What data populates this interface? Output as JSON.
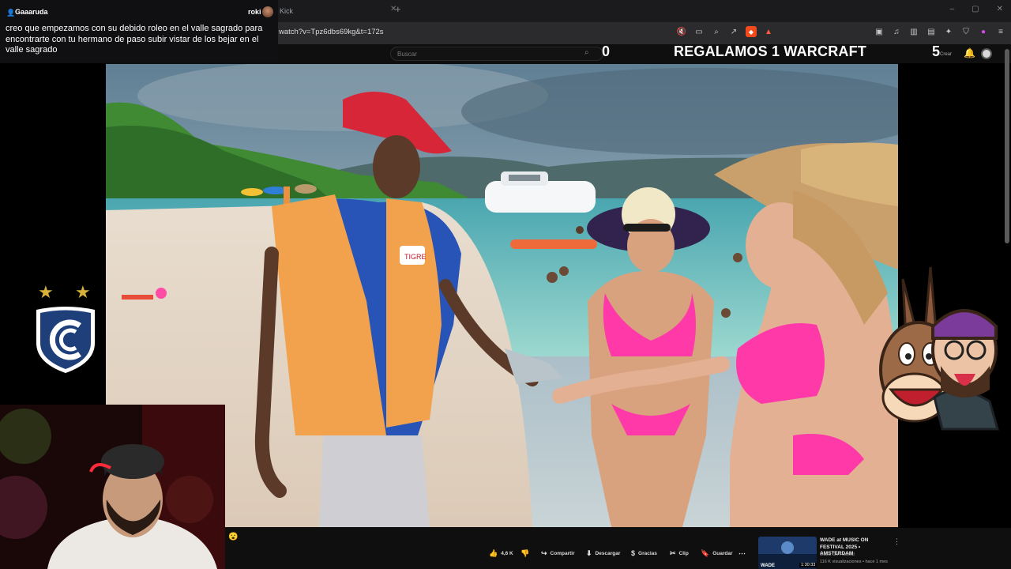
{
  "browser": {
    "tab_title": "Kick",
    "url": "watch?v=Tpz6dbs69kg&t=172s",
    "window_controls": [
      "–",
      "▢",
      "✕"
    ]
  },
  "youtube": {
    "search_placeholder": "Buscar",
    "create_label": "Crear"
  },
  "overlay": {
    "counter_left": "0",
    "promo_text": "REGALAMOS 1 WARCRAFT",
    "counter_right": "5"
  },
  "chat": {
    "username": "Gaaaruda",
    "reply_to": "roki",
    "message": "creo que empezamos con su debido roleo en el valle sagrado para encontrarte con tu hermano de paso subir vistar de los bejar en el valle sagrado"
  },
  "actions": {
    "likes": "4,6 K",
    "share": "Compartir",
    "download": "Descargar",
    "thanks": "Gracias",
    "clip": "Clip",
    "save": "Guardar"
  },
  "recommended": {
    "title": "WADE at MUSIC ON FESTIVAL 2025 • AMSTERDAM",
    "channel": "Music On Festival",
    "stats": "116 K visualizaciones • hace 1 mes",
    "duration": "1:30:33",
    "thumb_text": "WADE"
  },
  "colors": {
    "accent_red": "#e53935",
    "star_gold": "#d8b13a",
    "bikini_pink": "#ff3aa8",
    "vest_orange": "#f2a24c"
  }
}
